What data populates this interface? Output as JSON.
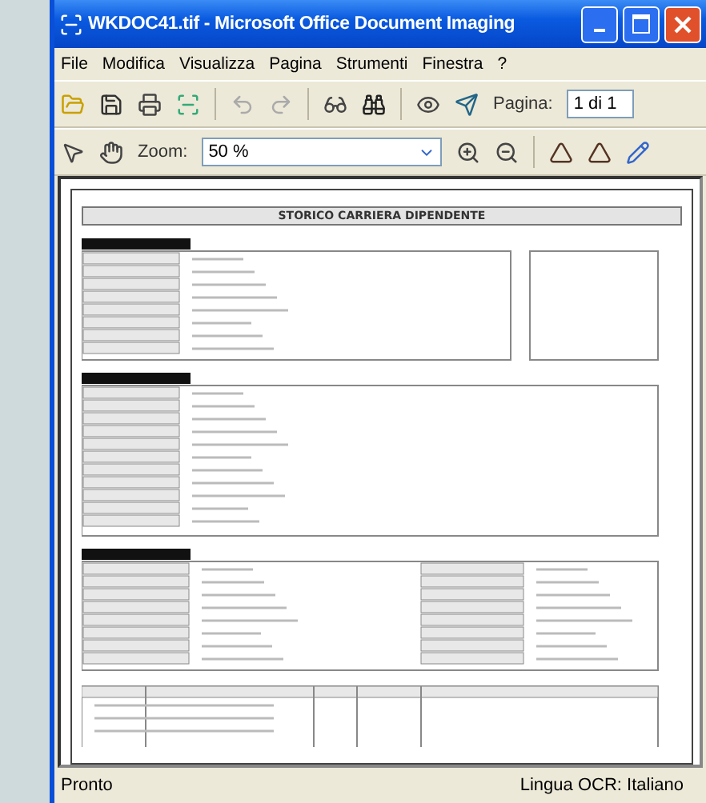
{
  "window": {
    "title": "WKDOC41.tif - Microsoft Office Document Imaging"
  },
  "menu": [
    "File",
    "Modifica",
    "Visualizza",
    "Pagina",
    "Strumenti",
    "Finestra",
    "?"
  ],
  "toolbar": {
    "page_label": "Pagina:",
    "page_value": "1 di 1"
  },
  "zoom_bar": {
    "label": "Zoom:",
    "value": "50 %"
  },
  "document": {
    "title": "STORICO CARRIERA DIPENDENTE"
  },
  "status_bar": {
    "left": "Pronto",
    "right": "Lingua OCR: Italiano"
  }
}
